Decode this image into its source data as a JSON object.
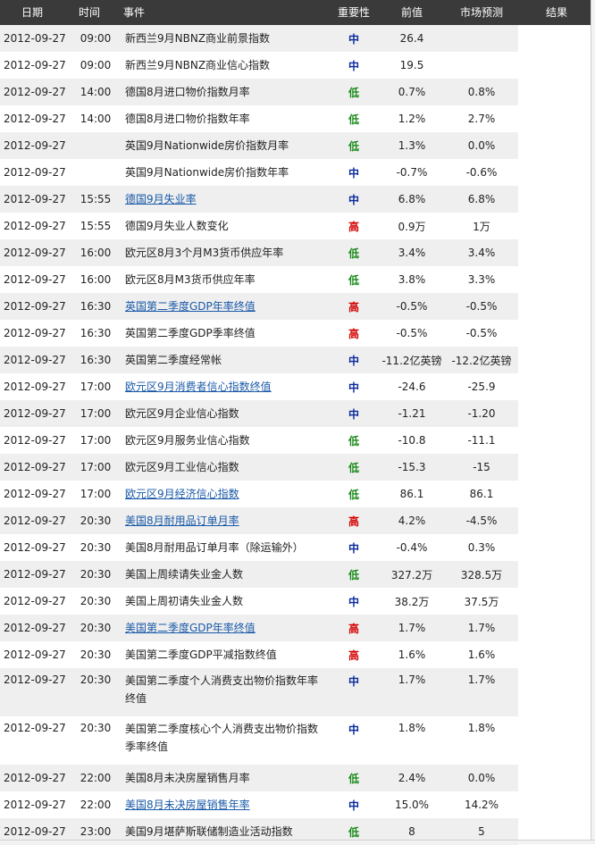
{
  "header": {
    "date": "日期",
    "time": "时间",
    "event": "事件",
    "importance": "重要性",
    "previous": "前值",
    "forecast": "市场预测",
    "result": "结果"
  },
  "importance_colors": {
    "高": "#d40000",
    "中": "#0a2a9c",
    "低": "#1a8a1a"
  },
  "rows": [
    {
      "date": "2012-09-27",
      "time": "09:00",
      "event": "新西兰9月NBNZ商业前景指数",
      "link": false,
      "importance": "中",
      "previous": "26.4",
      "forecast": "",
      "result": ""
    },
    {
      "date": "2012-09-27",
      "time": "09:00",
      "event": "新西兰9月NBNZ商业信心指数",
      "link": false,
      "importance": "中",
      "previous": "19.5",
      "forecast": "",
      "result": ""
    },
    {
      "date": "2012-09-27",
      "time": "14:00",
      "event": "德国8月进口物价指数月率",
      "link": false,
      "importance": "低",
      "previous": "0.7%",
      "forecast": "0.8%",
      "result": ""
    },
    {
      "date": "2012-09-27",
      "time": "14:00",
      "event": "德国8月进口物价指数年率",
      "link": false,
      "importance": "低",
      "previous": "1.2%",
      "forecast": "2.7%",
      "result": ""
    },
    {
      "date": "2012-09-27",
      "time": "",
      "event": "英国9月Nationwide房价指数月率",
      "link": false,
      "importance": "低",
      "previous": "1.3%",
      "forecast": "0.0%",
      "result": ""
    },
    {
      "date": "2012-09-27",
      "time": "",
      "event": "英国9月Nationwide房价指数年率",
      "link": false,
      "importance": "中",
      "previous": "-0.7%",
      "forecast": "-0.6%",
      "result": ""
    },
    {
      "date": "2012-09-27",
      "time": "15:55",
      "event": "德国9月失业率",
      "link": true,
      "importance": "中",
      "previous": "6.8%",
      "forecast": "6.8%",
      "result": ""
    },
    {
      "date": "2012-09-27",
      "time": "15:55",
      "event": "德国9月失业人数变化",
      "link": false,
      "importance": "高",
      "previous": "0.9万",
      "forecast": "1万",
      "result": ""
    },
    {
      "date": "2012-09-27",
      "time": "16:00",
      "event": "欧元区8月3个月M3货币供应年率",
      "link": false,
      "importance": "低",
      "previous": "3.4%",
      "forecast": "3.4%",
      "result": ""
    },
    {
      "date": "2012-09-27",
      "time": "16:00",
      "event": "欧元区8月M3货币供应年率",
      "link": false,
      "importance": "低",
      "previous": "3.8%",
      "forecast": "3.3%",
      "result": ""
    },
    {
      "date": "2012-09-27",
      "time": "16:30",
      "event": "英国第二季度GDP年率终值",
      "link": true,
      "importance": "高",
      "previous": "-0.5%",
      "forecast": "-0.5%",
      "result": ""
    },
    {
      "date": "2012-09-27",
      "time": "16:30",
      "event": "英国第二季度GDP季率终值",
      "link": false,
      "importance": "高",
      "previous": "-0.5%",
      "forecast": "-0.5%",
      "result": ""
    },
    {
      "date": "2012-09-27",
      "time": "16:30",
      "event": "英国第二季度经常帐",
      "link": false,
      "importance": "中",
      "previous": "-11.2亿英镑",
      "forecast": "-12.2亿英镑",
      "result": ""
    },
    {
      "date": "2012-09-27",
      "time": "17:00",
      "event": "欧元区9月消费者信心指数终值",
      "link": true,
      "importance": "中",
      "previous": "-24.6",
      "forecast": "-25.9",
      "result": ""
    },
    {
      "date": "2012-09-27",
      "time": "17:00",
      "event": "欧元区9月企业信心指数",
      "link": false,
      "importance": "中",
      "previous": "-1.21",
      "forecast": "-1.20",
      "result": ""
    },
    {
      "date": "2012-09-27",
      "time": "17:00",
      "event": "欧元区9月服务业信心指数",
      "link": false,
      "importance": "低",
      "previous": "-10.8",
      "forecast": "-11.1",
      "result": ""
    },
    {
      "date": "2012-09-27",
      "time": "17:00",
      "event": "欧元区9月工业信心指数",
      "link": false,
      "importance": "低",
      "previous": "-15.3",
      "forecast": "-15",
      "result": ""
    },
    {
      "date": "2012-09-27",
      "time": "17:00",
      "event": "欧元区9月经济信心指数",
      "link": true,
      "importance": "低",
      "previous": "86.1",
      "forecast": "86.1",
      "result": ""
    },
    {
      "date": "2012-09-27",
      "time": "20:30",
      "event": "美国8月耐用品订单月率",
      "link": true,
      "importance": "高",
      "previous": "4.2%",
      "forecast": "-4.5%",
      "result": ""
    },
    {
      "date": "2012-09-27",
      "time": "20:30",
      "event": "美国8月耐用品订单月率（除运输外）",
      "link": false,
      "importance": "中",
      "previous": "-0.4%",
      "forecast": "0.3%",
      "result": ""
    },
    {
      "date": "2012-09-27",
      "time": "20:30",
      "event": "美国上周续请失业金人数",
      "link": false,
      "importance": "低",
      "previous": "327.2万",
      "forecast": "328.5万",
      "result": ""
    },
    {
      "date": "2012-09-27",
      "time": "20:30",
      "event": "美国上周初请失业金人数",
      "link": false,
      "importance": "中",
      "previous": "38.2万",
      "forecast": "37.5万",
      "result": ""
    },
    {
      "date": "2012-09-27",
      "time": "20:30",
      "event": "美国第二季度GDP年率终值",
      "link": true,
      "importance": "高",
      "previous": "1.7%",
      "forecast": "1.7%",
      "result": ""
    },
    {
      "date": "2012-09-27",
      "time": "20:30",
      "event": "美国第二季度GDP平减指数终值",
      "link": false,
      "importance": "高",
      "previous": "1.6%",
      "forecast": "1.6%",
      "result": ""
    },
    {
      "date": "2012-09-27",
      "time": "20:30",
      "event": "美国第二季度个人消费支出物价指数年率终值",
      "link": false,
      "importance": "中",
      "previous": "1.7%",
      "forecast": "1.7%",
      "result": "",
      "tall": true
    },
    {
      "date": "2012-09-27",
      "time": "20:30",
      "event": "美国第二季度核心个人消费支出物价指数季率终值",
      "link": false,
      "importance": "中",
      "previous": "1.8%",
      "forecast": "1.8%",
      "result": "",
      "tall": true
    },
    {
      "date": "2012-09-27",
      "time": "22:00",
      "event": "美国8月未决房屋销售月率",
      "link": false,
      "importance": "低",
      "previous": "2.4%",
      "forecast": "0.0%",
      "result": ""
    },
    {
      "date": "2012-09-27",
      "time": "22:00",
      "event": "美国8月未决房屋销售年率",
      "link": true,
      "importance": "中",
      "previous": "15.0%",
      "forecast": "14.2%",
      "result": ""
    },
    {
      "date": "2012-09-27",
      "time": "23:00",
      "event": "美国9月堪萨斯联储制造业活动指数",
      "link": false,
      "importance": "低",
      "previous": "8",
      "forecast": "5",
      "result": ""
    }
  ]
}
